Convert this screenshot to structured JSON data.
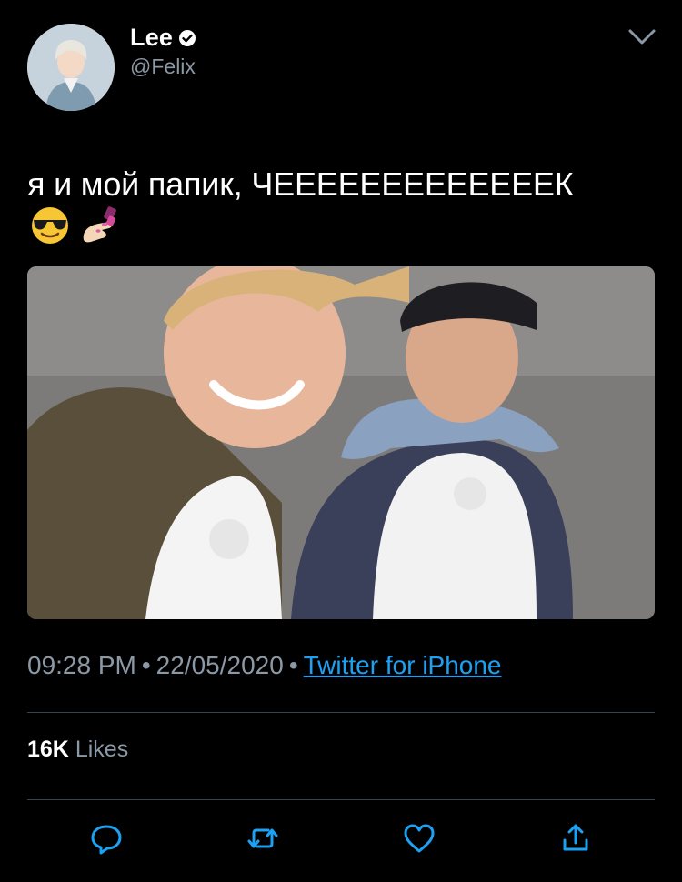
{
  "tweet": {
    "author": {
      "display_name": "Lee",
      "handle": "@Felix",
      "verified": true
    },
    "text": "я и мой папик, ЧЕЕЕЕЕЕЕЕЕЕЕЕЕК",
    "emojis": [
      "smiling-face-with-sunglasses",
      "nail-polish"
    ],
    "time": "09:28 PM",
    "date": "22/05/2020",
    "separator": "•",
    "source": "Twitter for iPhone",
    "likes_count": "16K",
    "likes_label": "Likes"
  },
  "actions": [
    "reply-icon",
    "retweet-icon",
    "like-icon",
    "share-icon"
  ],
  "colors": {
    "background": "#000000",
    "text": "#ffffff",
    "secondary": "#8b98a5",
    "link": "#1da1f2",
    "divider": "#38444d"
  }
}
